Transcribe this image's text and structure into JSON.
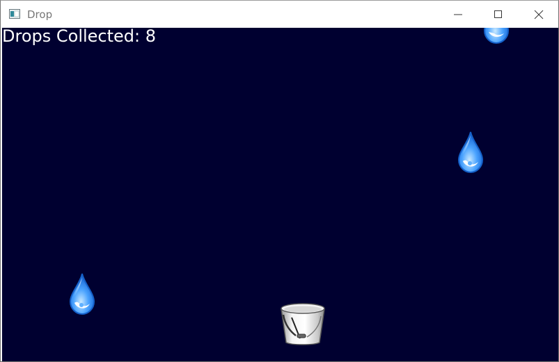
{
  "window": {
    "title": "Drop",
    "icon": "app-window-icon",
    "controls": {
      "minimize": "minimize-icon",
      "maximize": "maximize-icon",
      "close": "close-icon"
    }
  },
  "game": {
    "background_color": "#000030",
    "score_text": "Drops Collected: 8",
    "objects": {
      "raindrop": "water-drop-icon",
      "bucket": "bucket-icon"
    }
  }
}
